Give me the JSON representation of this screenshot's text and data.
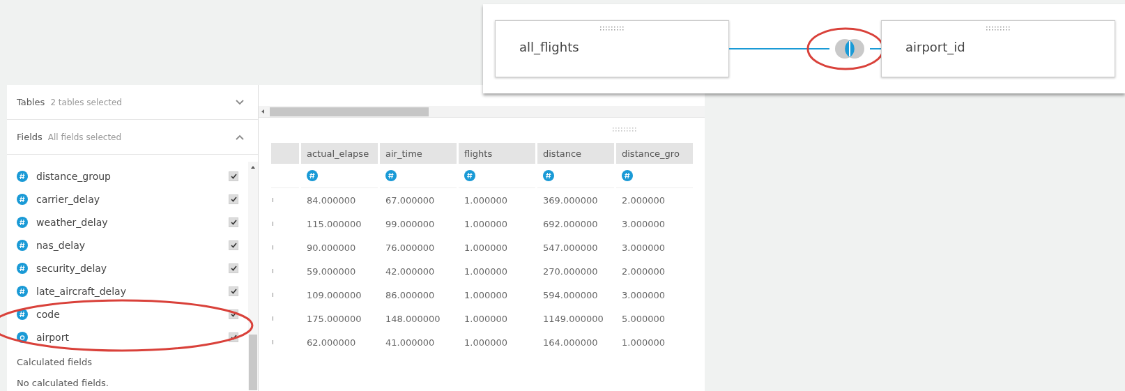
{
  "join_editor": {
    "tables": [
      {
        "name": "all_flights"
      },
      {
        "name": "airport_id"
      }
    ]
  },
  "sidebar": {
    "tables_section": {
      "title": "Tables",
      "summary": "2 tables selected",
      "expanded": false
    },
    "fields_section": {
      "title": "Fields",
      "summary": "All fields selected",
      "expanded": true
    },
    "fields": [
      {
        "name": "distance_group",
        "kind": "number",
        "checked": true
      },
      {
        "name": "carrier_delay",
        "kind": "number",
        "checked": true
      },
      {
        "name": "weather_delay",
        "kind": "number",
        "checked": true
      },
      {
        "name": "nas_delay",
        "kind": "number",
        "checked": true
      },
      {
        "name": "security_delay",
        "kind": "number",
        "checked": true
      },
      {
        "name": "late_aircraft_delay",
        "kind": "number",
        "checked": true
      },
      {
        "name": "code",
        "kind": "number",
        "checked": true
      },
      {
        "name": "airport",
        "kind": "string",
        "checked": true
      }
    ],
    "calculated_title": "Calculated fields",
    "calculated_empty": "No calculated fields."
  },
  "table": {
    "columns": [
      {
        "name": "actual_elapse",
        "kind": "number"
      },
      {
        "name": "air_time",
        "kind": "number"
      },
      {
        "name": "flights",
        "kind": "number"
      },
      {
        "name": "distance",
        "kind": "number"
      },
      {
        "name": "distance_gro",
        "kind": "number"
      }
    ],
    "rows": [
      [
        "84.000000",
        "67.000000",
        "1.000000",
        "369.000000",
        "2.000000"
      ],
      [
        "115.000000",
        "99.000000",
        "1.000000",
        "692.000000",
        "3.000000"
      ],
      [
        "90.000000",
        "76.000000",
        "1.000000",
        "547.000000",
        "3.000000"
      ],
      [
        "59.000000",
        "42.000000",
        "1.000000",
        "270.000000",
        "2.000000"
      ],
      [
        "109.000000",
        "86.000000",
        "1.000000",
        "594.000000",
        "3.000000"
      ],
      [
        "175.000000",
        "148.000000",
        "1.000000",
        "1149.000000",
        "5.000000"
      ],
      [
        "62.000000",
        "41.000000",
        "1.000000",
        "164.000000",
        "1.000000"
      ]
    ]
  }
}
